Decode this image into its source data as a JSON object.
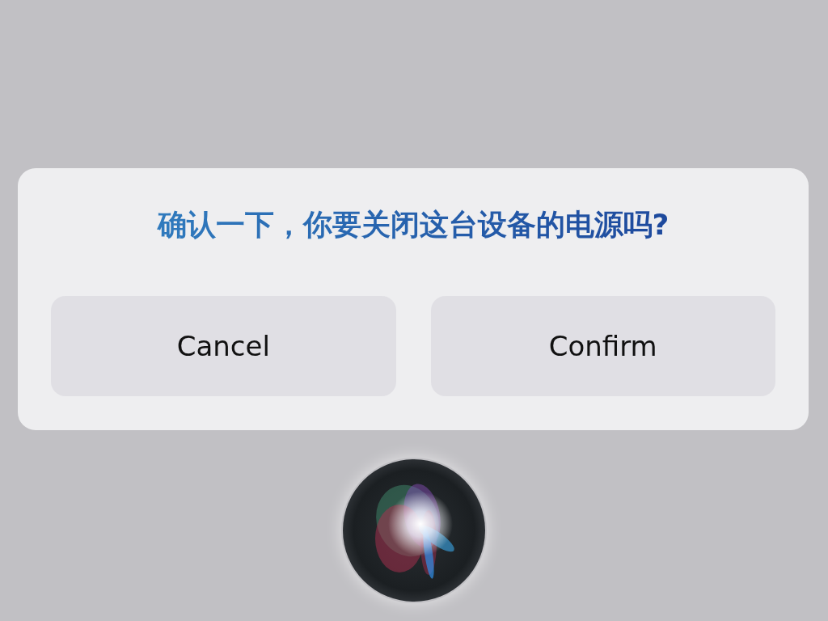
{
  "dialog": {
    "title": "确认一下，你要关闭这台设备的电源吗?",
    "buttons": [
      {
        "label": "Cancel"
      },
      {
        "label": "Confirm"
      }
    ]
  }
}
